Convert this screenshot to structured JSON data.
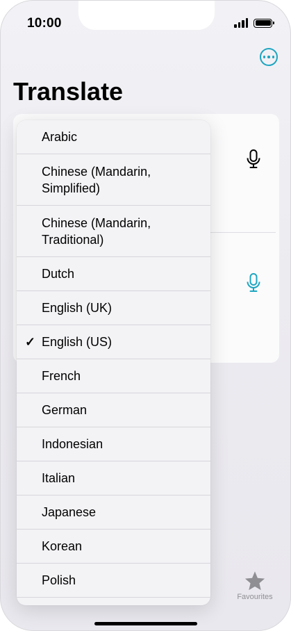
{
  "status_bar": {
    "time": "10:00"
  },
  "header": {
    "title": "Translate"
  },
  "colors": {
    "accent": "#1ea5c0",
    "card_bg": "#fbfbfc",
    "menu_bg": "#f3f3f6"
  },
  "icons": {
    "more": "ellipsis-circle-icon",
    "mic": "microphone-icon",
    "favourites": "star-icon",
    "check": "checkmark-icon"
  },
  "tabbar": {
    "favourites_label": "Favourites"
  },
  "language_menu": {
    "selected": "English (US)",
    "items": [
      {
        "label": "Arabic"
      },
      {
        "label": "Chinese (Mandarin,\nSimplified)"
      },
      {
        "label": "Chinese (Mandarin,\nTraditional)"
      },
      {
        "label": "Dutch"
      },
      {
        "label": "English (UK)"
      },
      {
        "label": "English (US)",
        "check": "✓"
      },
      {
        "label": "French"
      },
      {
        "label": "German"
      },
      {
        "label": "Indonesian"
      },
      {
        "label": "Italian"
      },
      {
        "label": "Japanese"
      },
      {
        "label": "Korean"
      },
      {
        "label": "Polish"
      }
    ]
  }
}
